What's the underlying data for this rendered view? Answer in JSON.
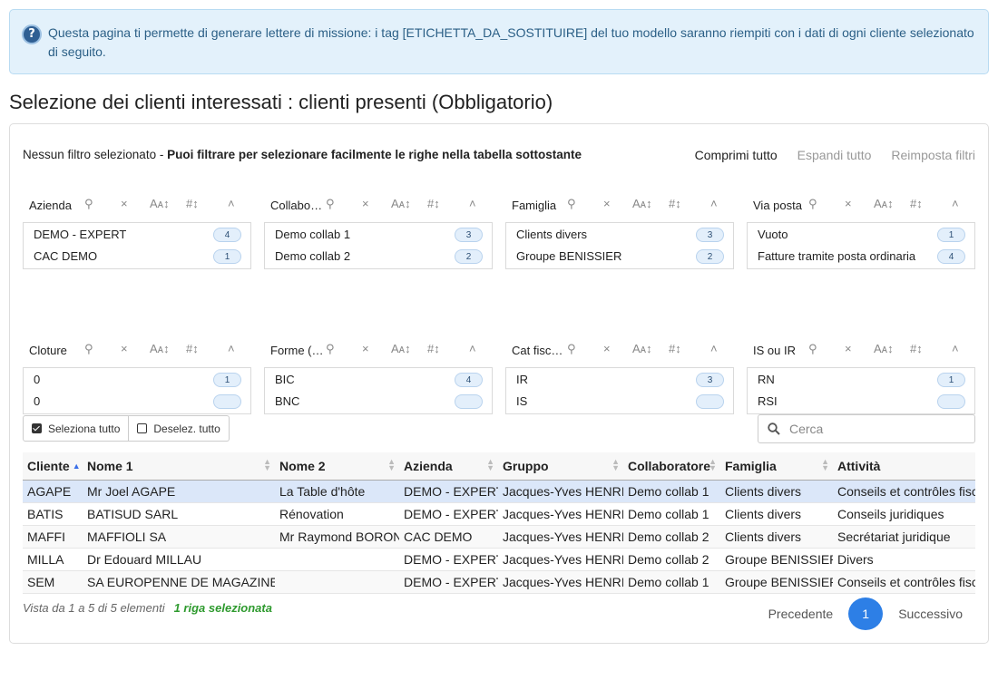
{
  "info": {
    "text": "Questa pagina ti permette di generare lettere di missione: i tag [ETICHETTA_DA_SOSTITUIRE] del tuo modello saranno riempiti con i dati di ogni cliente selezionato di seguito.",
    "icon": "question-icon"
  },
  "section_title": "Selezione dei clienti interessati : clienti presenti (Obbligatorio)",
  "filter_bar": {
    "status": "Nessun filtro selezionato - ",
    "hint": "Puoi filtrare per selezionare facilmente le righe nella tabella sottostante",
    "collapse_all": "Comprimi tutto",
    "expand_all": "Espandi tutto",
    "reset_filters": "Reimposta filtri"
  },
  "pane_controls": {
    "search": "⚲",
    "clear": "×",
    "sort_alpha": "Aᴀ↕",
    "sort_num": "#↕",
    "collapse": "˄"
  },
  "panes": [
    {
      "title": "Azienda",
      "rows": [
        {
          "label": "DEMO - EXPERT",
          "count": "4"
        },
        {
          "label": "CAC DEMO",
          "count": "1"
        }
      ]
    },
    {
      "title": "Collaboratore",
      "rows": [
        {
          "label": "Demo collab 1",
          "count": "3"
        },
        {
          "label": "Demo collab 2",
          "count": "2"
        }
      ]
    },
    {
      "title": "Famiglia",
      "rows": [
        {
          "label": "Clients divers",
          "count": "3"
        },
        {
          "label": "Groupe BENISSIER",
          "count": "2"
        }
      ]
    },
    {
      "title": "Via posta",
      "rows": [
        {
          "label": "Vuoto",
          "count": "1"
        },
        {
          "label": "Fatture tramite posta ordinaria",
          "count": "4"
        }
      ]
    },
    {
      "title": "Cloture",
      "rows": [
        {
          "label": "0",
          "count": "1"
        },
        {
          "label": "0",
          "count": ""
        }
      ]
    },
    {
      "title": "Forme (sociale)",
      "rows": [
        {
          "label": "BIC",
          "count": "4"
        },
        {
          "label": "BNC",
          "count": ""
        }
      ]
    },
    {
      "title": "Cat fiscale",
      "rows": [
        {
          "label": "IR",
          "count": "3"
        },
        {
          "label": "IS",
          "count": ""
        }
      ]
    },
    {
      "title": "IS ou IR",
      "rows": [
        {
          "label": "RN",
          "count": "1"
        },
        {
          "label": "RSI",
          "count": ""
        }
      ]
    }
  ],
  "buttons": {
    "select_all": "Seleziona tutto",
    "deselect_all": "Deselez. tutto"
  },
  "search": {
    "placeholder": "Cerca",
    "value": ""
  },
  "table": {
    "headers": [
      "Cliente",
      "Nome 1",
      "Nome 2",
      "Azienda",
      "Gruppo",
      "Collaboratore",
      "Famiglia",
      "Attività"
    ],
    "rows": [
      [
        "AGAPE",
        "Mr Joel AGAPE",
        "La Table d'hôte",
        "DEMO - EXPERT",
        "Jacques-Yves HENRI",
        "Demo collab 1",
        "Clients divers",
        "Conseils et contrôles fiscaux"
      ],
      [
        "BATIS",
        "BATISUD SARL",
        "Rénovation",
        "DEMO - EXPERT",
        "Jacques-Yves HENRI",
        "Demo collab 1",
        "Clients divers",
        "Conseils juridiques"
      ],
      [
        "MAFFI",
        "MAFFIOLI SA",
        "Mr Raymond BORON",
        "CAC DEMO",
        "Jacques-Yves HENRI",
        "Demo collab 2",
        "Clients divers",
        "Secrétariat juridique"
      ],
      [
        "MILLA",
        "Dr Edouard MILLAU",
        "",
        "DEMO - EXPERT",
        "Jacques-Yves HENRI",
        "Demo collab 2",
        "Groupe BENISSIER",
        "Divers"
      ],
      [
        "SEM",
        "SA EUROPENNE DE MAGAZINES",
        "",
        "DEMO - EXPERT",
        "Jacques-Yves HENRI",
        "Demo collab 1",
        "Groupe BENISSIER",
        "Conseils et contrôles fiscaux"
      ]
    ],
    "selected_row": 0,
    "sorted_column": 0
  },
  "footer": {
    "info": "Vista da 1 a 5 di 5 elementi",
    "selected": "1 riga selezionata"
  },
  "pagination": {
    "previous": "Precedente",
    "current": "1",
    "next": "Successivo"
  },
  "colors": {
    "accent": "#2d7fe6",
    "info_bg": "#e3f1fb",
    "selected_row": "#dbe7f9",
    "selected_text": "#2e9a2e"
  }
}
